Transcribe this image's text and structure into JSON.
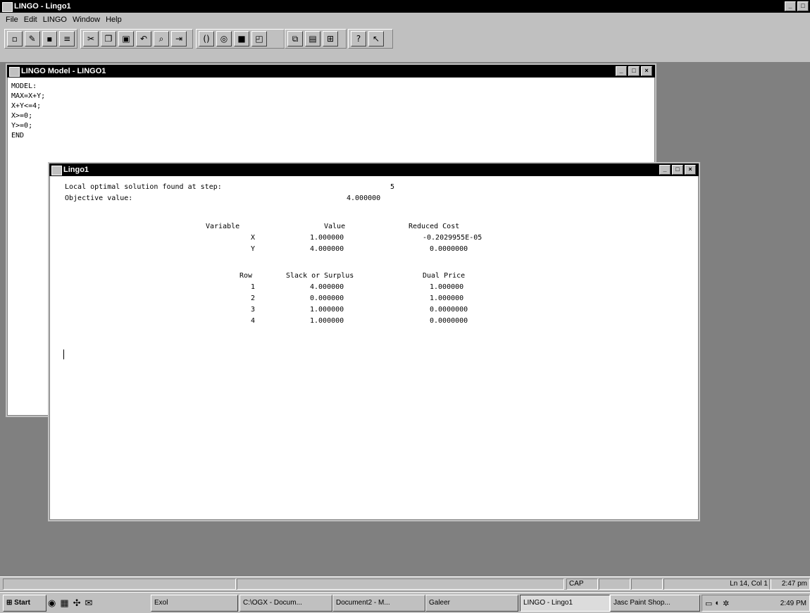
{
  "app": {
    "title": "LINGO - Lingo1",
    "menu": [
      "File",
      "Edit",
      "LINGO",
      "Window",
      "Help"
    ]
  },
  "toolbar": {
    "icons": [
      "new-icon",
      "open-icon",
      "save-icon",
      "print-icon",
      "cut-icon",
      "copy-icon",
      "paste-icon",
      "undo-icon",
      "find-icon",
      "goto-icon",
      "match-paren-icon",
      "solve-icon",
      "stop-icon",
      "send-to-back-icon",
      "tile-icon",
      "cascade-icon",
      "arrange-icon",
      "help-icon",
      "context-help-icon"
    ]
  },
  "model_window": {
    "title": "LINGO Model - LINGO1",
    "lines": [
      "MODEL:",
      "MAX=X+Y;",
      "X+Y<=4;",
      "X>=0;",
      "Y>=0;",
      "END"
    ]
  },
  "report_window": {
    "title": "Lingo1",
    "header": {
      "solution_label": "Local optimal solution found at step:",
      "solution_step": "5",
      "objective_label": "Objective value:",
      "objective_value": "4.000000"
    },
    "var_table": {
      "headers": [
        "Variable",
        "Value",
        "Reduced Cost"
      ],
      "rows": [
        [
          "X",
          "1.000000",
          "-0.2029955E-05"
        ],
        [
          "Y",
          "4.000000",
          "0.0000000"
        ]
      ]
    },
    "row_table": {
      "headers": [
        "Row",
        "Slack or Surplus",
        "Dual Price"
      ],
      "rows": [
        [
          "1",
          "4.000000",
          "1.000000"
        ],
        [
          "2",
          "0.000000",
          "1.000000"
        ],
        [
          "3",
          "1.000000",
          "0.0000000"
        ],
        [
          "4",
          "1.000000",
          "0.0000000"
        ]
      ]
    }
  },
  "statusbar": {
    "mode": "CAP",
    "position": "Ln 14, Col 1",
    "clock": "2:47 pm"
  },
  "taskbar": {
    "start_label": "Start",
    "tasks": [
      {
        "label": "Exol",
        "active": false
      },
      {
        "label": "C:\\OGX - Docum...",
        "active": false
      },
      {
        "label": "Document2 - M...",
        "active": false
      },
      {
        "label": "Galeer",
        "active": false
      },
      {
        "label": "LINGO - Lingo1",
        "active": true
      },
      {
        "label": "Jasc Paint Shop...",
        "active": false
      }
    ],
    "tray_time": "2:49 PM"
  }
}
